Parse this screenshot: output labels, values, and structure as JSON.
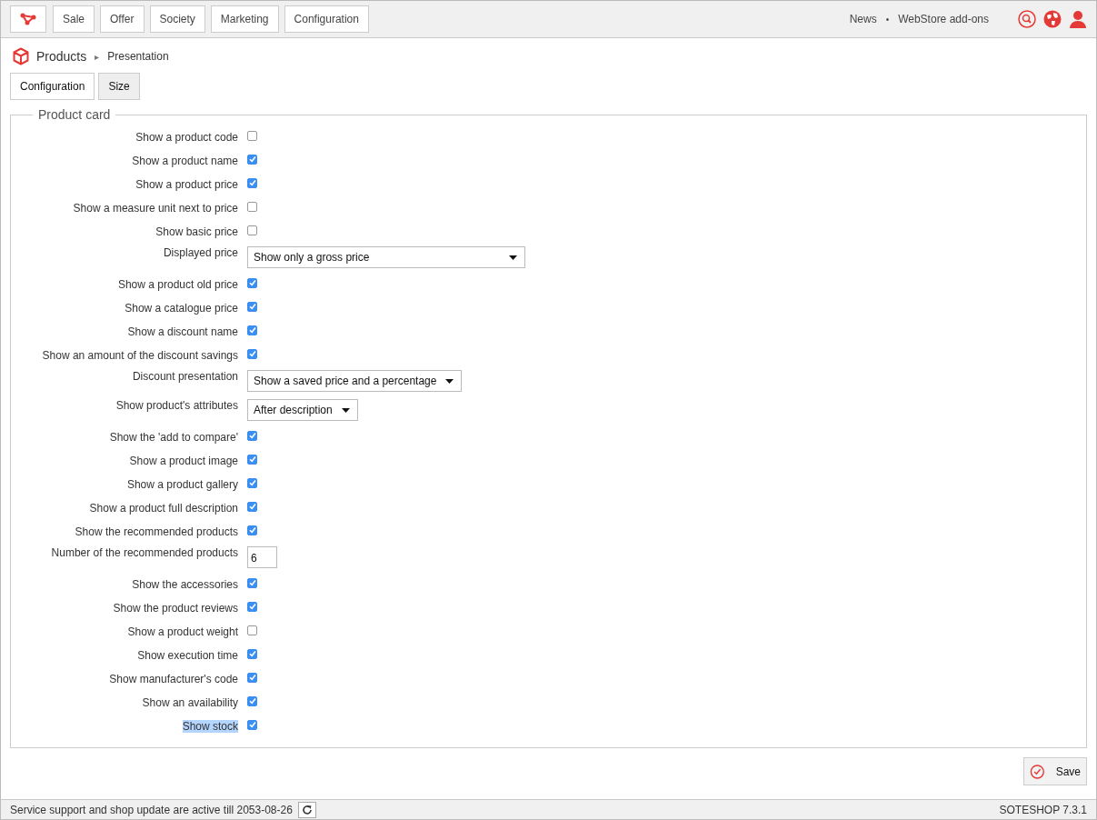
{
  "top_nav": {
    "items": [
      {
        "label": "Sale"
      },
      {
        "label": "Offer"
      },
      {
        "label": "Society"
      },
      {
        "label": "Marketing"
      },
      {
        "label": "Configuration"
      }
    ],
    "links": [
      "News",
      "•",
      "WebStore add-ons"
    ]
  },
  "breadcrumb": {
    "section": "Products",
    "separator": "▸",
    "page": "Presentation"
  },
  "tabs": [
    {
      "label": "Configuration",
      "selected": true
    },
    {
      "label": "Size",
      "selected": false
    }
  ],
  "fieldset": {
    "legend": "Product card",
    "rows": [
      {
        "kind": "checkbox",
        "label": "Show a product code",
        "checked": false,
        "highlighted": false
      },
      {
        "kind": "checkbox",
        "label": "Show a product name",
        "checked": true,
        "highlighted": false
      },
      {
        "kind": "checkbox",
        "label": "Show a product price",
        "checked": true,
        "highlighted": false
      },
      {
        "kind": "checkbox",
        "label": "Show a measure unit next to price",
        "checked": false,
        "highlighted": false
      },
      {
        "kind": "checkbox",
        "label": "Show basic price",
        "checked": false,
        "highlighted": false
      },
      {
        "kind": "select",
        "label": "Displayed price",
        "value": "Show only a gross price",
        "wide": true,
        "highlighted": false
      },
      {
        "kind": "checkbox",
        "label": "Show a product old price",
        "checked": true,
        "highlighted": false
      },
      {
        "kind": "checkbox",
        "label": "Show a catalogue price",
        "checked": true,
        "highlighted": false
      },
      {
        "kind": "checkbox",
        "label": "Show a discount name",
        "checked": true,
        "highlighted": false
      },
      {
        "kind": "checkbox",
        "label": "Show an amount of the discount savings",
        "checked": true,
        "highlighted": false
      },
      {
        "kind": "select",
        "label": "Discount presentation",
        "value": "Show a saved price and a percentage",
        "wide": false,
        "highlighted": false
      },
      {
        "kind": "select",
        "label": "Show product's attributes",
        "value": "After description",
        "wide": false,
        "highlighted": false
      },
      {
        "kind": "checkbox",
        "label": "Show the 'add to compare'",
        "checked": true,
        "highlighted": false
      },
      {
        "kind": "checkbox",
        "label": "Show a product image",
        "checked": true,
        "highlighted": false
      },
      {
        "kind": "checkbox",
        "label": "Show a product gallery",
        "checked": true,
        "highlighted": false
      },
      {
        "kind": "checkbox",
        "label": "Show a product full description",
        "checked": true,
        "highlighted": false
      },
      {
        "kind": "checkbox",
        "label": "Show the recommended products",
        "checked": true,
        "highlighted": false
      },
      {
        "kind": "input",
        "label": "Number of the recommended products",
        "value": "6",
        "highlighted": false
      },
      {
        "kind": "checkbox",
        "label": "Show the accessories",
        "checked": true,
        "highlighted": false
      },
      {
        "kind": "checkbox",
        "label": "Show the product reviews",
        "checked": true,
        "highlighted": false
      },
      {
        "kind": "checkbox",
        "label": "Show a product weight",
        "checked": false,
        "highlighted": false
      },
      {
        "kind": "checkbox",
        "label": "Show execution time",
        "checked": true,
        "highlighted": false
      },
      {
        "kind": "checkbox",
        "label": "Show manufacturer's code",
        "checked": true,
        "highlighted": false
      },
      {
        "kind": "checkbox",
        "label": "Show an availability",
        "checked": true,
        "highlighted": false
      },
      {
        "kind": "checkbox",
        "label": "Show stock",
        "checked": true,
        "highlighted": true
      }
    ]
  },
  "save_button": "Save",
  "status_bar": {
    "message": "Service support and shop update are active till 2053-08-26",
    "version": "SOTESHOP 7.3.1"
  }
}
